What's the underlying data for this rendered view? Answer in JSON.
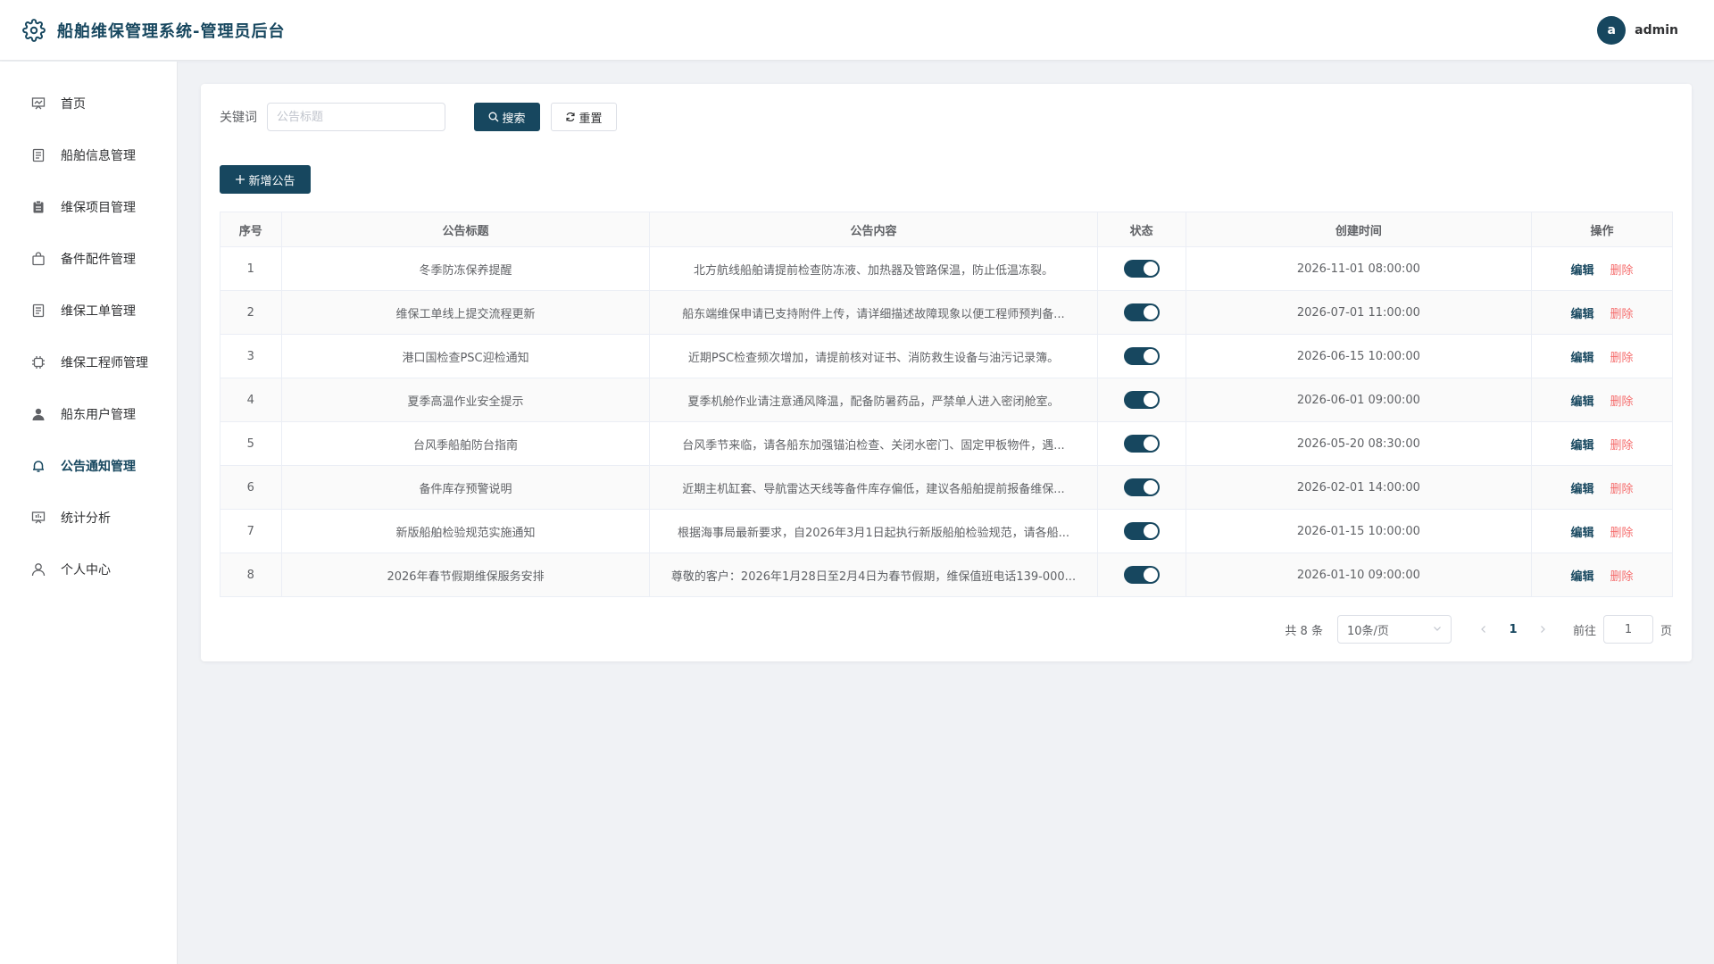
{
  "header": {
    "title": "船舶维保管理系统-管理员后台",
    "avatar_letter": "a",
    "username": "admin",
    "logo_icon": "gear-icon"
  },
  "sidebar": {
    "items": [
      {
        "label": "首页",
        "icon": "presentation-icon",
        "active": false
      },
      {
        "label": "船舶信息管理",
        "icon": "document-icon",
        "active": false
      },
      {
        "label": "维保项目管理",
        "icon": "clipboard-icon",
        "active": false
      },
      {
        "label": "备件配件管理",
        "icon": "shopping-bag-icon",
        "active": false
      },
      {
        "label": "维保工单管理",
        "icon": "document-icon",
        "active": false
      },
      {
        "label": "维保工程师管理",
        "icon": "cpu-icon",
        "active": false
      },
      {
        "label": "船东用户管理",
        "icon": "user-filled-icon",
        "active": false
      },
      {
        "label": "公告通知管理",
        "icon": "bell-icon",
        "active": true
      },
      {
        "label": "统计分析",
        "icon": "data-board-icon",
        "active": false
      },
      {
        "label": "个人中心",
        "icon": "user-icon",
        "active": false
      }
    ]
  },
  "filter": {
    "keyword_label": "关键词",
    "keyword_placeholder": "公告标题",
    "keyword_value": "",
    "search_label": "搜索",
    "reset_label": "重置"
  },
  "actions": {
    "add_label": "新增公告"
  },
  "table": {
    "columns": [
      "序号",
      "公告标题",
      "公告内容",
      "状态",
      "创建时间",
      "操作"
    ],
    "edit_label": "编辑",
    "delete_label": "删除",
    "rows": [
      {
        "index": "1",
        "title": "冬季防冻保养提醒",
        "content": "北方航线船舶请提前检查防冻液、加热器及管路保温，防止低温冻裂。",
        "enabled": true,
        "created": "2026-11-01 08:00:00"
      },
      {
        "index": "2",
        "title": "维保工单线上提交流程更新",
        "content": "船东端维保申请已支持附件上传，请详细描述故障现象以便工程师预判备...",
        "enabled": true,
        "created": "2026-07-01 11:00:00"
      },
      {
        "index": "3",
        "title": "港口国检查PSC迎检通知",
        "content": "近期PSC检查频次增加，请提前核对证书、消防救生设备与油污记录簿。",
        "enabled": true,
        "created": "2026-06-15 10:00:00"
      },
      {
        "index": "4",
        "title": "夏季高温作业安全提示",
        "content": "夏季机舱作业请注意通风降温，配备防暑药品，严禁单人进入密闭舱室。",
        "enabled": true,
        "created": "2026-06-01 09:00:00"
      },
      {
        "index": "5",
        "title": "台风季船舶防台指南",
        "content": "台风季节来临，请各船东加强锚泊检查、关闭水密门、固定甲板物件，遇...",
        "enabled": true,
        "created": "2026-05-20 08:30:00"
      },
      {
        "index": "6",
        "title": "备件库存预警说明",
        "content": "近期主机缸套、导航雷达天线等备件库存偏低，建议各船舶提前报备维保...",
        "enabled": true,
        "created": "2026-02-01 14:00:00"
      },
      {
        "index": "7",
        "title": "新版船舶检验规范实施通知",
        "content": "根据海事局最新要求，自2026年3月1日起执行新版船舶检验规范，请各船...",
        "enabled": true,
        "created": "2026-01-15 10:00:00"
      },
      {
        "index": "8",
        "title": "2026年春节假期维保服务安排",
        "content": "尊敬的客户：2026年1月28日至2月4日为春节假期，维保值班电话139-000...",
        "enabled": true,
        "created": "2026-01-10 09:00:00"
      }
    ]
  },
  "pagination": {
    "total_text": "共 8 条",
    "page_size": "10条/页",
    "current_page": "1",
    "goto_label": "前往",
    "goto_value": "1",
    "page_suffix": "页"
  },
  "colors": {
    "primary": "#17475f",
    "danger": "#f56c6c",
    "background": "#f0f2f5"
  }
}
